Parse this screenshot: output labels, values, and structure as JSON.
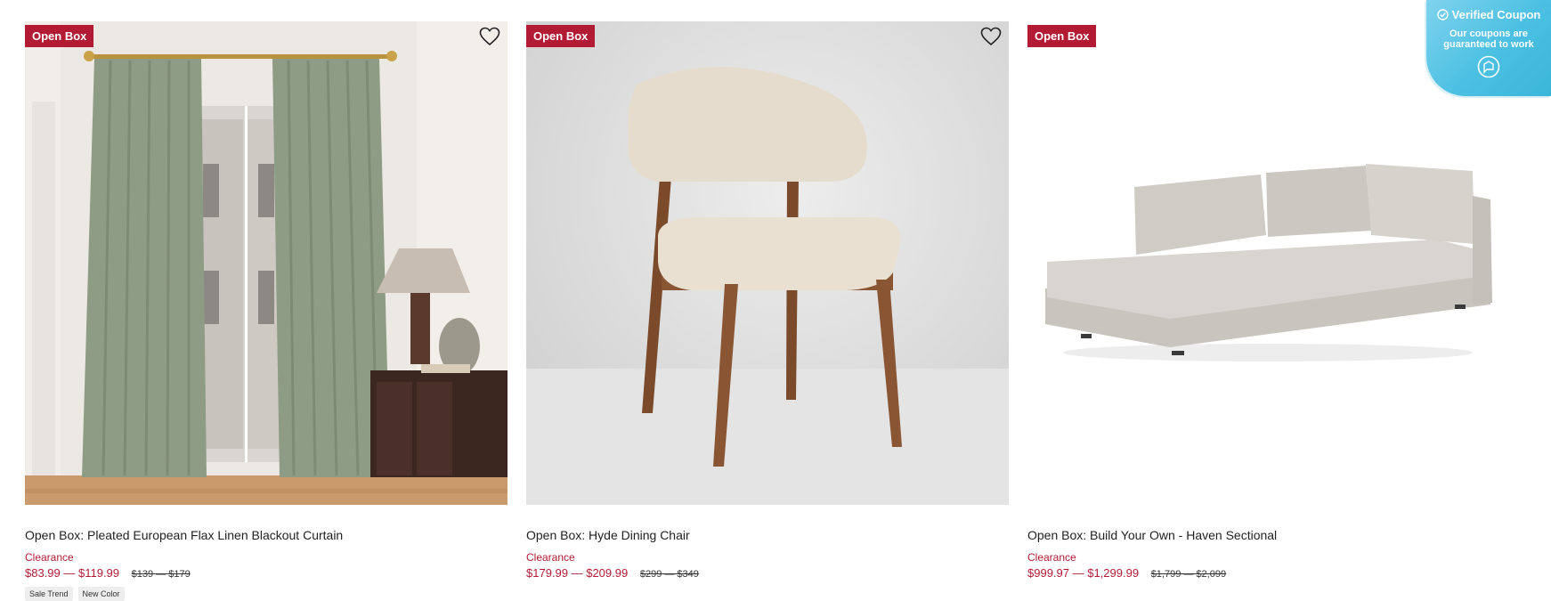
{
  "coupon_widget": {
    "title": "Verified Coupon",
    "subtitle": "Our coupons are guaranteed to work",
    "icon": "chat-bubble-icon",
    "accent": "#4bc0e2"
  },
  "products": [
    {
      "badge": "Open Box",
      "title": "Open Box: Pleated European Flax Linen Blackout Curtain",
      "status": "Clearance",
      "price_range": "$83.99 — $119.99",
      "original_price": "$139 — $179",
      "chips": [
        "Sale Trend",
        "New Color"
      ]
    },
    {
      "badge": "Open Box",
      "title": "Open Box: Hyde Dining Chair",
      "status": "Clearance",
      "price_range": "$179.99 — $209.99",
      "original_price": "$299 — $349",
      "chips": []
    },
    {
      "badge": "Open Box",
      "title": "Open Box: Build Your Own - Haven Sectional",
      "status": "Clearance",
      "price_range": "$999.97 — $1,299.99",
      "original_price": "$1,799 — $2,099",
      "chips": []
    }
  ],
  "colors": {
    "sale_red": "#b31b34",
    "text": "#222222"
  }
}
